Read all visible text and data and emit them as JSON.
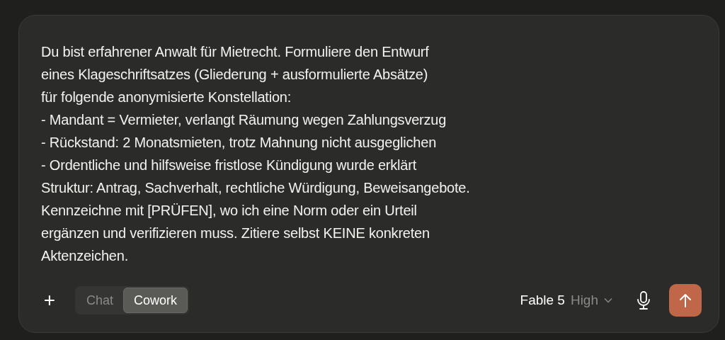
{
  "composer": {
    "value": "Du bist erfahrener Anwalt für Mietrecht. Formuliere den Entwurf\neines Klageschriftsatzes (Gliederung + ausformulierte Absätze)\nfür folgende anonymisierte Konstellation:\n- Mandant = Vermieter, verlangt Räumung wegen Zahlungsverzug\n- Rückstand: 2 Monatsmieten, trotz Mahnung nicht ausgeglichen\n- Ordentliche und hilfsweise fristlose Kündigung wurde erklärt\nStruktur: Antrag, Sachverhalt, rechtliche Würdigung, Beweisangebote.\nKennzeichne mit [PRÜFEN], wo ich eine Norm oder ein Urteil\nergänzen und verifizieren muss. Zitiere selbst KEINE konkreten\nAktenzeichen."
  },
  "add_button": {
    "label": "+"
  },
  "modes": [
    {
      "label": "Chat",
      "selected": false
    },
    {
      "label": "Cowork",
      "selected": true
    }
  ],
  "model": {
    "name": "Fable 5",
    "effort": "High"
  }
}
